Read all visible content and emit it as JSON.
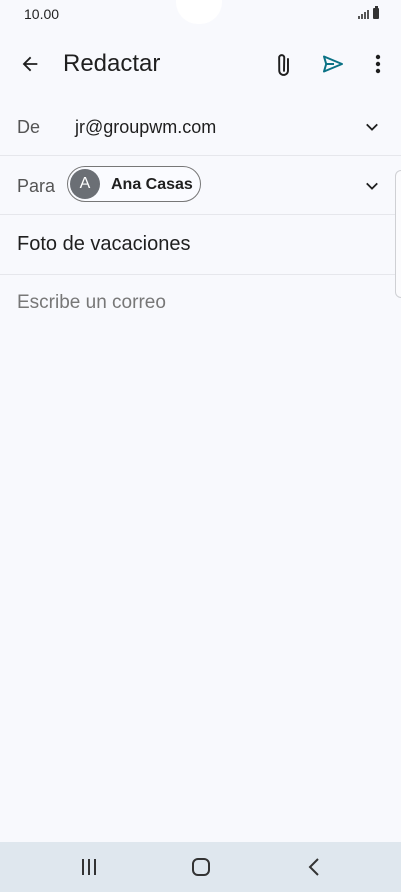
{
  "status_bar": {
    "time": "10.00",
    "signal_icon": "signal-icon",
    "battery_icon": "battery-icon"
  },
  "toolbar": {
    "title": "Redactar",
    "back_icon": "arrow-back-icon",
    "attach_icon": "paperclip-icon",
    "send_icon": "send-icon",
    "more_icon": "more-vert-icon",
    "send_color": "#0b7285"
  },
  "compose": {
    "from": {
      "label": "De",
      "value": "jr@groupwm.com"
    },
    "to": {
      "label": "Para",
      "recipient": {
        "initial": "A",
        "name": "Ana Casas"
      }
    },
    "subject": "Foto de vacaciones",
    "body_placeholder": "Escribe un correo"
  },
  "nav_bar": {
    "recents_icon": "recents-icon",
    "home_icon": "home-icon",
    "back_icon": "nav-back-icon"
  }
}
